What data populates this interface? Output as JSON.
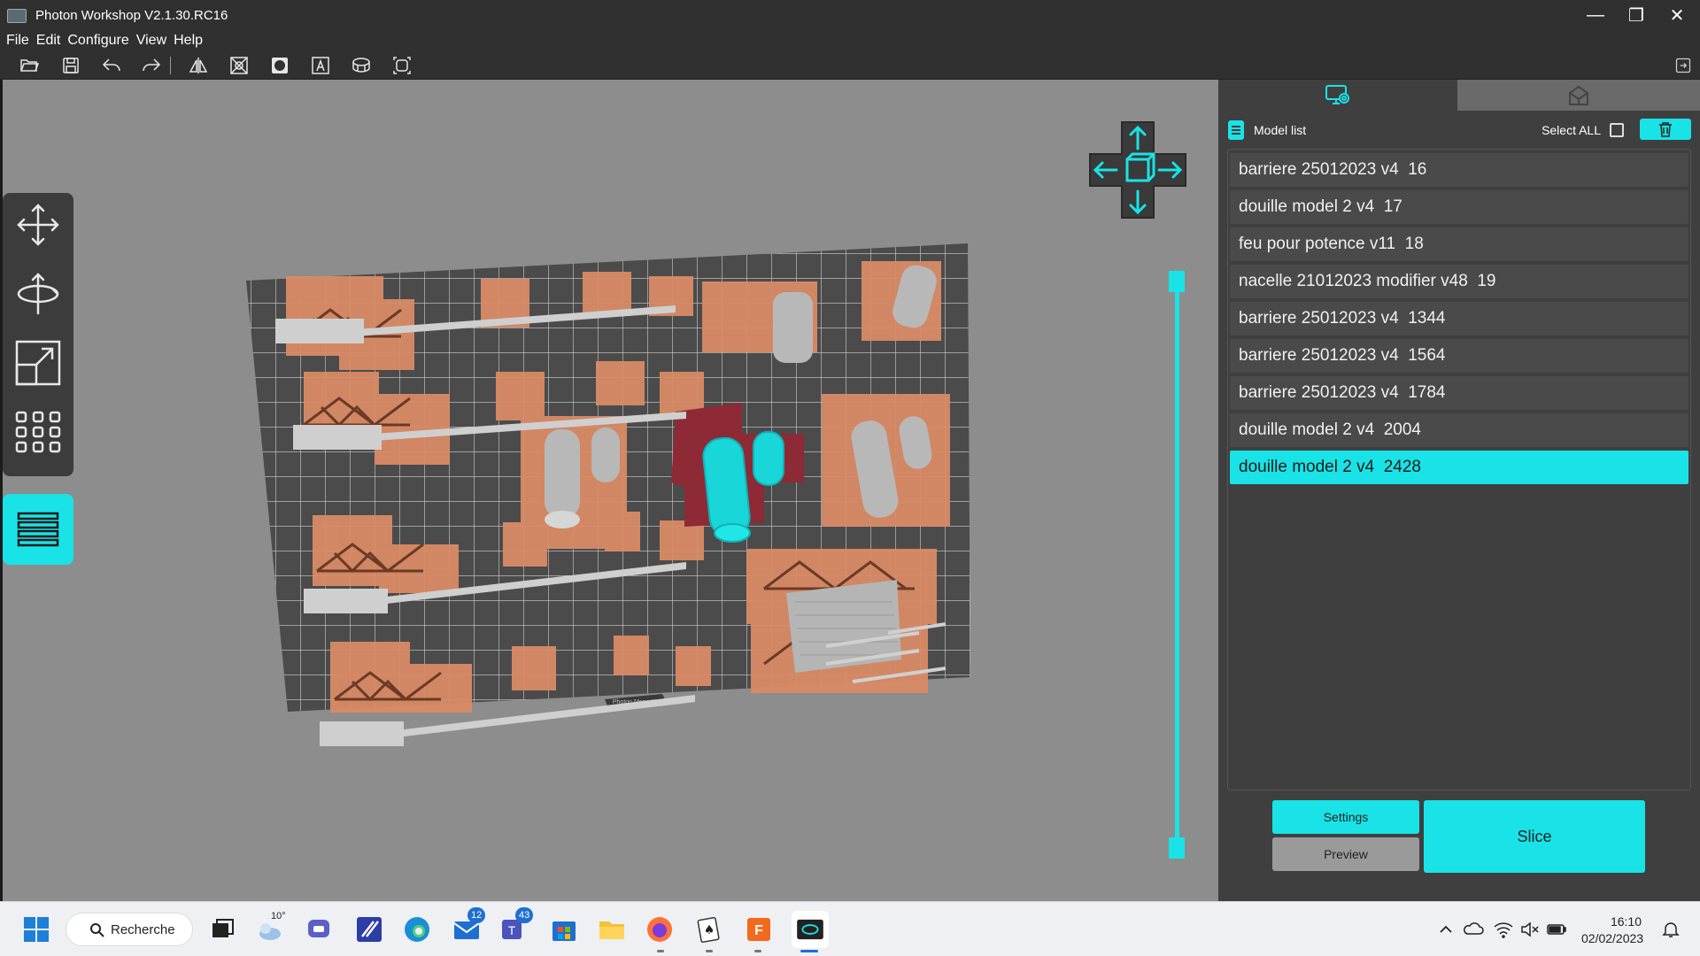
{
  "window": {
    "title": "Photon Workshop V2.1.30.RC16",
    "controls": {
      "minimize": "—",
      "restore": "❐",
      "close": "✕"
    }
  },
  "menu": [
    "File",
    "Edit",
    "Configure",
    "View",
    "Help"
  ],
  "toolbar": {
    "icons": [
      "open-icon",
      "save-icon",
      "undo-icon",
      "redo-icon",
      "mirror-icon",
      "hollow-icon",
      "punch-icon",
      "text-icon",
      "support-icon",
      "layout-icon"
    ]
  },
  "left_tools": [
    "move-icon",
    "rotate-icon",
    "scale-icon",
    "arrange-icon",
    "layer-slice-icon"
  ],
  "printer_label": "Photon Mono X",
  "slider": {
    "top_value": 1.0,
    "bottom_value": 0.0
  },
  "right_panel": {
    "tabs": [
      "model-settings-icon",
      "printer-icon"
    ],
    "model_list_title": "Model list",
    "select_all_label": "Select ALL",
    "select_all_checked": false,
    "models": [
      {
        "name": "barriere 25012023 v4  16",
        "selected": false
      },
      {
        "name": "douille model 2 v4  17",
        "selected": false
      },
      {
        "name": "feu pour potence v11  18",
        "selected": false
      },
      {
        "name": "nacelle 21012023 modifier v48  19",
        "selected": false
      },
      {
        "name": "barriere 25012023 v4  1344",
        "selected": false
      },
      {
        "name": "barriere 25012023 v4  1564",
        "selected": false
      },
      {
        "name": "barriere 25012023 v4  1784",
        "selected": false
      },
      {
        "name": "douille model 2 v4  2004",
        "selected": false
      },
      {
        "name": "douille model 2 v4  2428",
        "selected": true
      }
    ],
    "buttons": {
      "settings": "Settings",
      "preview": "Preview",
      "slice": "Slice"
    }
  },
  "taskbar": {
    "search_label": "Recherche",
    "weather_temp": "10°",
    "mail_badge": "12",
    "teams_badge": "43",
    "time": "16:10",
    "date": "02/02/2023"
  },
  "colors": {
    "accent": "#19e3e6",
    "panel": "#3f3f3f",
    "viewport": "#8d8d8d",
    "raft": "#d98b66",
    "selected_model": "#19e3e6",
    "selected_raft": "#8e2a35"
  }
}
